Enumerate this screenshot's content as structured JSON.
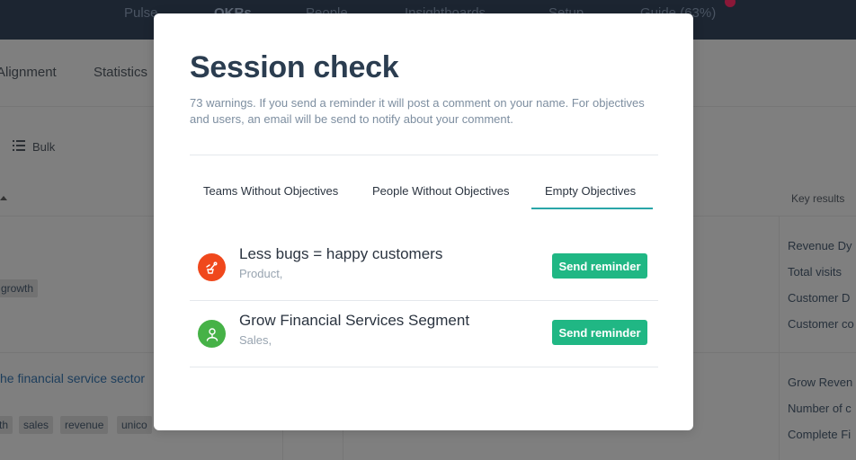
{
  "colors": {
    "accent": "#20b784",
    "tab_underline": "#2aa6a8",
    "icon_product": "#f0481c",
    "icon_sales": "#46b247",
    "modal_bg": "#ffffff",
    "title": "#2b3d50"
  },
  "background": {
    "top_nav": [
      "Pulse",
      "OKRs",
      "People",
      "Insightboards",
      "Setup",
      "Guide (63%)"
    ],
    "sub_nav": [
      "Alignment",
      "Statistics"
    ],
    "bulk_label": "Bulk",
    "key_results_header": "Key results",
    "objective_title_partial": "he financial service sector",
    "tag_growth": "growth",
    "tags_row": [
      "th",
      "sales",
      "revenue",
      "unico"
    ],
    "key_results_group1": [
      "Revenue Dy",
      "Total visits",
      "Customer D",
      "Customer co"
    ],
    "key_results_group2": [
      "Grow Reven",
      "Number of c",
      "Complete Fi"
    ]
  },
  "modal": {
    "title": "Session check",
    "description": "73 warnings. If you send a reminder it will post a comment on your name. For objectives and users, an email will be send to notify about your comment.",
    "tabs": [
      {
        "label": "Teams Without Objectives",
        "active": false
      },
      {
        "label": "People Without Objectives",
        "active": false
      },
      {
        "label": "Empty Objectives",
        "active": true
      }
    ],
    "rows": [
      {
        "title": "Less bugs = happy customers",
        "subtitle": "Product,",
        "icon": "product-icon",
        "button": "Send reminder"
      },
      {
        "title": "Grow Financial Services Segment",
        "subtitle": "Sales,",
        "icon": "sales-icon",
        "button": "Send reminder"
      }
    ]
  }
}
